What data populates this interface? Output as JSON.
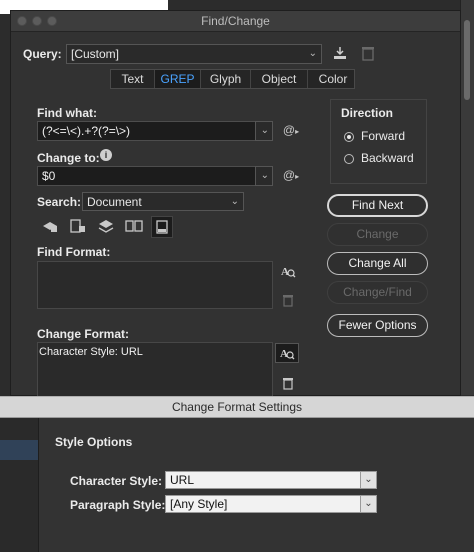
{
  "window": {
    "title": "Find/Change"
  },
  "query": {
    "label": "Query:",
    "value": "[Custom]"
  },
  "tabs": [
    {
      "label": "Text"
    },
    {
      "label": "GREP"
    },
    {
      "label": "Glyph"
    },
    {
      "label": "Object"
    },
    {
      "label": "Color"
    }
  ],
  "find_what": {
    "label": "Find what:",
    "value": "(?<=\\<).+?(?=\\>)"
  },
  "change_to": {
    "label": "Change to:",
    "value": "$0"
  },
  "search": {
    "label": "Search:",
    "value": "Document"
  },
  "direction": {
    "label": "Direction",
    "options": [
      {
        "label": "Forward",
        "selected": true
      },
      {
        "label": "Backward",
        "selected": false
      }
    ]
  },
  "buttons": {
    "find_next": "Find Next",
    "change": "Change",
    "change_all": "Change All",
    "change_find": "Change/Find",
    "fewer_options": "Fewer Options"
  },
  "find_format": {
    "label": "Find Format:",
    "value": ""
  },
  "change_format": {
    "label": "Change Format:",
    "value": "Character Style: URL"
  },
  "change_format_settings": {
    "title": "Change Format Settings",
    "section": "Style Options",
    "character_style": {
      "label": "Character Style:",
      "value": "URL"
    },
    "paragraph_style": {
      "label": "Paragraph Style:",
      "value": "[Any Style]"
    }
  },
  "colors": {
    "accent": "#4aa3ff",
    "panel": "#323232",
    "field": "#1c1c1c"
  },
  "icons": {
    "at": "@",
    "save_query": "save-query-icon",
    "delete_query": "trash-icon"
  }
}
